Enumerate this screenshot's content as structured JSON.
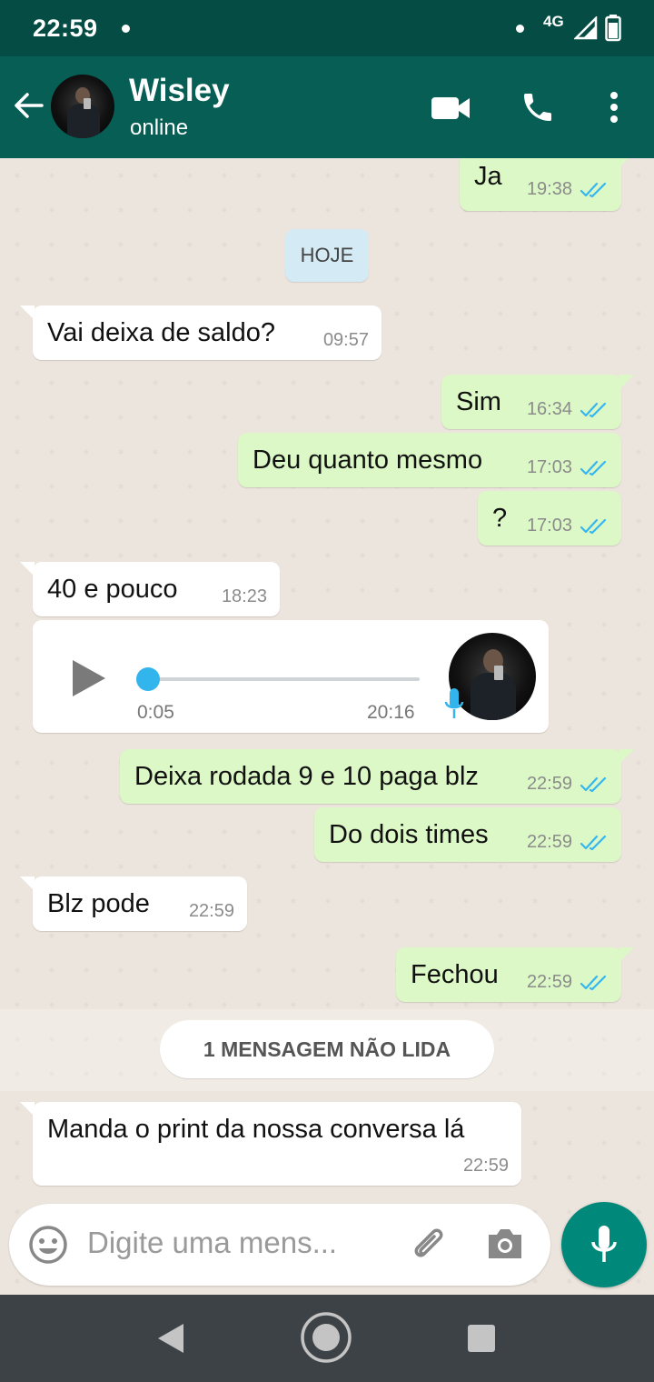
{
  "status_bar": {
    "time": "22:59",
    "network": "4G"
  },
  "header": {
    "contact_name": "Wisley",
    "contact_status": "online"
  },
  "date_chip": "HOJE",
  "messages": [
    {
      "text": "Ja",
      "time": "19:38"
    },
    {
      "text": "Vai deixa de saldo?",
      "time": "09:57"
    },
    {
      "text": "Sim",
      "time": "16:34"
    },
    {
      "text": "Deu quanto mesmo",
      "time": "17:03"
    },
    {
      "text": "?",
      "time": "17:03"
    },
    {
      "text": "40 e pouco",
      "time": "18:23"
    },
    {
      "text": "Deixa rodada 9 e 10 paga blz",
      "time": "22:59"
    },
    {
      "text": "Do dois times",
      "time": "22:59"
    },
    {
      "text": "Blz pode",
      "time": "22:59"
    },
    {
      "text": "Fechou",
      "time": "22:59"
    },
    {
      "text": "Manda o print da nossa conversa lá",
      "time": "22:59"
    }
  ],
  "audio_message": {
    "duration": "0:05",
    "time": "20:16",
    "progress": 0
  },
  "unread_banner": "1 MENSAGEM NÃO LIDA",
  "input": {
    "placeholder": "Digite uma mens..."
  },
  "colors": {
    "header": "#075e54",
    "status_bar": "#054d44",
    "outgoing_bubble": "#dcf8c6",
    "incoming_bubble": "#ffffff",
    "read_ticks": "#34b7f1",
    "mic_button": "#00897b"
  },
  "icons": [
    "back-arrow-icon",
    "video-call-icon",
    "phone-icon",
    "more-vert-icon",
    "double-check-icon",
    "play-icon",
    "mic-icon",
    "emoji-icon",
    "attach-icon",
    "camera-icon",
    "nav-back-icon",
    "nav-home-icon",
    "nav-recent-icon"
  ]
}
